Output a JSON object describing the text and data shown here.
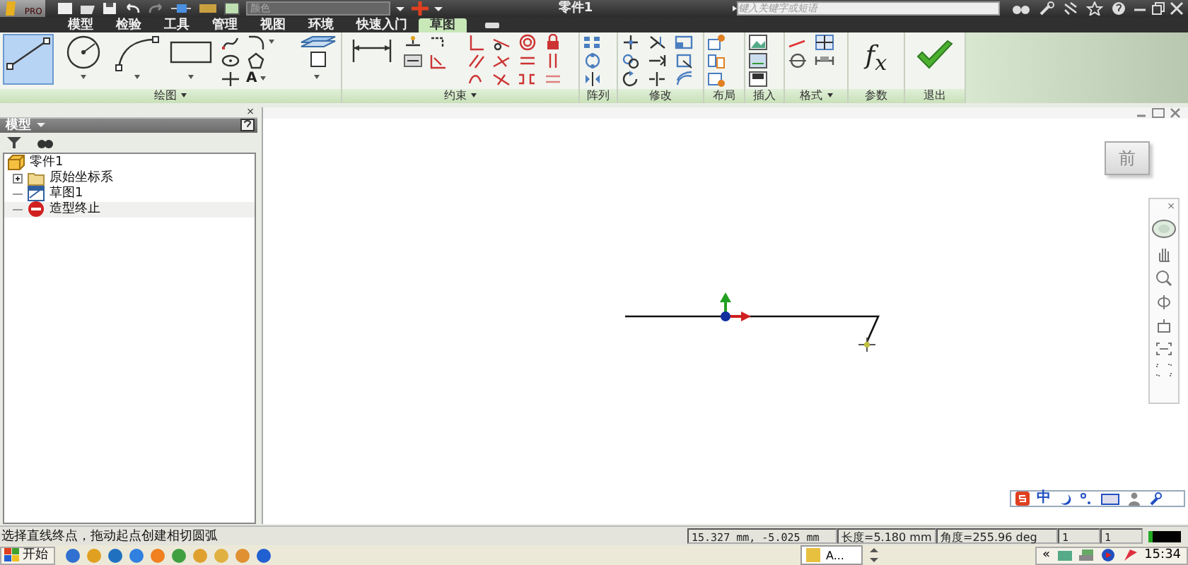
{
  "title_bar": {
    "app_edition": "PRO",
    "color_field": {
      "placeholder": "颜色"
    },
    "title": "零件1",
    "search": {
      "placeholder": "键入关键字或短语"
    }
  },
  "tabs": [
    {
      "label": "模型",
      "selected": false
    },
    {
      "label": "检验",
      "selected": false
    },
    {
      "label": "工具",
      "selected": false
    },
    {
      "label": "管理",
      "selected": false
    },
    {
      "label": "视图",
      "selected": false
    },
    {
      "label": "环境",
      "selected": false
    },
    {
      "label": "快速入门",
      "selected": false
    },
    {
      "label": "草图",
      "selected": true
    }
  ],
  "ribbon": {
    "draw_tools": [
      {
        "kind": "line",
        "selected": true
      },
      {
        "kind": "circle",
        "selected": false
      },
      {
        "kind": "arc",
        "selected": false
      },
      {
        "kind": "rectangle",
        "selected": false
      }
    ],
    "text_tool": "A",
    "parameters_glyph": "f$_{x}$",
    "panels": [
      {
        "kind": "draw",
        "label": "绘图",
        "has_menu": true
      },
      {
        "kind": "constrain",
        "label": "约束",
        "has_menu": true
      },
      {
        "kind": "pattern",
        "label": "阵列",
        "has_menu": false
      },
      {
        "kind": "modify",
        "label": "修改",
        "has_menu": false
      },
      {
        "kind": "layout",
        "label": "布局",
        "has_menu": false
      },
      {
        "kind": "insert",
        "label": "插入",
        "has_menu": false
      },
      {
        "kind": "format",
        "label": "格式",
        "has_menu": true
      },
      {
        "kind": "parameters",
        "label": "参数",
        "has_menu": false
      },
      {
        "kind": "finish",
        "label": "退出",
        "has_menu": false
      }
    ]
  },
  "browser": {
    "close": "×",
    "header": "模型",
    "tree": [
      {
        "label": "零件1",
        "selected": false,
        "children": [
          {
            "label": "原始坐标系",
            "selected": false,
            "expanded": false
          },
          {
            "label": "草图1",
            "selected": false
          },
          {
            "label": "造型终止",
            "selected": true
          }
        ]
      }
    ]
  },
  "canvas": {
    "view_cube": "前",
    "navigation_close": "×"
  },
  "ime_bar": {
    "mode": "中"
  },
  "status_bar": {
    "prompt": "选择直线终点，拖动起点创建相切圆弧",
    "coordinates": "15.327 mm, -5.025 mm",
    "length": "长度=5.180 mm",
    "angle": "角度=255.96 deg",
    "field_1": "1",
    "field_2": "1"
  },
  "taskbar": {
    "start": "开始",
    "task": "A...",
    "tray_expand": "«",
    "clock": "15:34"
  }
}
